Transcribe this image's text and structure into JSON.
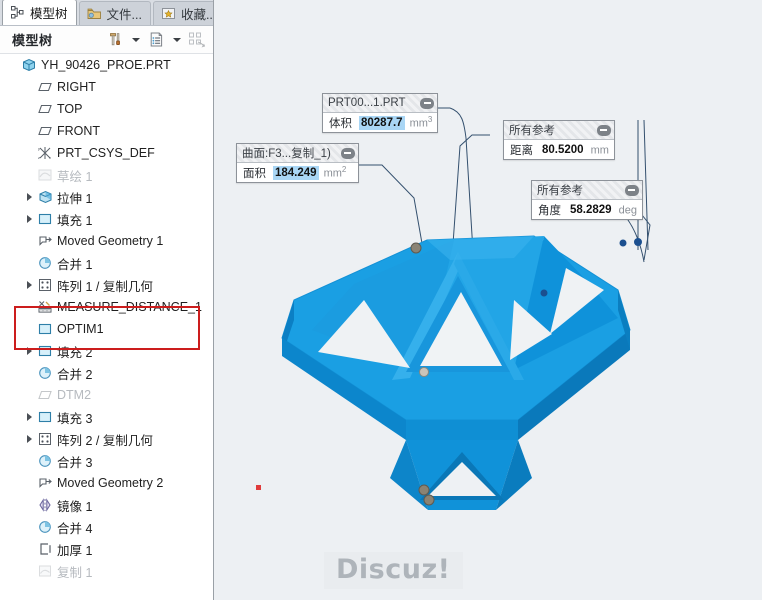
{
  "window": {
    "tabs": [
      {
        "label": "模型树",
        "icon": "model-tree-icon",
        "active": true
      },
      {
        "label": "文件...",
        "icon": "folder-icon",
        "active": false
      },
      {
        "label": "收藏...",
        "icon": "favorites-star-icon",
        "active": false
      }
    ]
  },
  "tree_toolbar": {
    "title": "模型树",
    "settings_icon": "tools-hammer-icon",
    "settings_caret": "chevron-down-icon",
    "display_icon": "list-settings-icon",
    "display_caret": "chevron-down-icon",
    "filter_icon": "tree-filter-off-icon"
  },
  "tree": {
    "items": [
      {
        "label": "YH_90426_PROE.PRT",
        "indent": 0,
        "icon": "part-icon",
        "expand": false,
        "dim": false
      },
      {
        "label": "RIGHT",
        "indent": 1,
        "icon": "datum-plane-icon",
        "expand": false,
        "dim": false
      },
      {
        "label": "TOP",
        "indent": 1,
        "icon": "datum-plane-icon",
        "expand": false,
        "dim": false
      },
      {
        "label": "FRONT",
        "indent": 1,
        "icon": "datum-plane-icon",
        "expand": false,
        "dim": false
      },
      {
        "label": "PRT_CSYS_DEF",
        "indent": 1,
        "icon": "csys-icon",
        "expand": false,
        "dim": false
      },
      {
        "label": "草绘 1",
        "indent": 1,
        "icon": "sketch-icon",
        "expand": false,
        "dim": true
      },
      {
        "label": "拉伸 1",
        "indent": 1,
        "icon": "extrude-icon",
        "expand": true,
        "dim": false
      },
      {
        "label": "填充 1",
        "indent": 1,
        "icon": "fill-icon",
        "expand": true,
        "dim": false
      },
      {
        "label": "Moved Geometry 1",
        "indent": 1,
        "icon": "moved-geometry-icon",
        "expand": false,
        "dim": false
      },
      {
        "label": "合并 1",
        "indent": 1,
        "icon": "merge-icon",
        "expand": false,
        "dim": false
      },
      {
        "label": "阵列 1 / 复制几何",
        "indent": 1,
        "icon": "pattern-icon",
        "expand": true,
        "dim": false
      },
      {
        "label": "MEASURE_DISTANCE_1",
        "indent": 1,
        "icon": "measure-distance-icon",
        "expand": false,
        "dim": false
      },
      {
        "label": "OPTIM1",
        "indent": 1,
        "icon": "fill-icon",
        "expand": false,
        "dim": false
      },
      {
        "label": "填充 2",
        "indent": 1,
        "icon": "fill-icon",
        "expand": true,
        "dim": false
      },
      {
        "label": "合并 2",
        "indent": 1,
        "icon": "merge-icon",
        "expand": false,
        "dim": false
      },
      {
        "label": "DTM2",
        "indent": 1,
        "icon": "datum-plane-icon",
        "expand": false,
        "dim": true
      },
      {
        "label": "填充 3",
        "indent": 1,
        "icon": "fill-icon",
        "expand": true,
        "dim": false
      },
      {
        "label": "阵列 2 / 复制几何",
        "indent": 1,
        "icon": "pattern-icon",
        "expand": true,
        "dim": false
      },
      {
        "label": "合并 3",
        "indent": 1,
        "icon": "merge-icon",
        "expand": false,
        "dim": false
      },
      {
        "label": "Moved Geometry 2",
        "indent": 1,
        "icon": "moved-geometry-icon",
        "expand": false,
        "dim": false
      },
      {
        "label": "镜像 1",
        "indent": 1,
        "icon": "mirror-icon",
        "expand": false,
        "dim": false
      },
      {
        "label": "合并 4",
        "indent": 1,
        "icon": "merge-icon",
        "expand": false,
        "dim": false
      },
      {
        "label": "加厚 1",
        "indent": 1,
        "icon": "thicken-icon",
        "expand": false,
        "dim": false
      },
      {
        "label": "复制 1",
        "indent": 1,
        "icon": "copy-icon",
        "expand": false,
        "dim": true
      }
    ],
    "selection_highlight_color": "#cc1d1d"
  },
  "callouts": [
    {
      "name": "volume-callout",
      "title": "PRT00...1.PRT",
      "label": "体积",
      "value": "80287.7",
      "unit": "mm",
      "unit_sup": "3",
      "collapse_icon": "minus-icon",
      "label_highlighted": false,
      "value_highlighted": true
    },
    {
      "name": "area-callout",
      "title": "曲面:F3...复制_1)",
      "label": "面积",
      "value": "184.249",
      "unit": "mm",
      "unit_sup": "2",
      "collapse_icon": "minus-icon",
      "label_highlighted": false,
      "value_highlighted": true
    },
    {
      "name": "distance-callout",
      "title": "所有参考",
      "label": "距离",
      "value": "80.5200",
      "unit": "mm",
      "unit_sup": "",
      "collapse_icon": "minus-icon",
      "label_highlighted": false,
      "value_highlighted": false
    },
    {
      "name": "angle-callout",
      "title": "所有参考",
      "label": "角度",
      "value": "58.2829",
      "unit": "deg",
      "unit_sup": "",
      "collapse_icon": "minus-icon",
      "label_highlighted": false,
      "value_highlighted": false
    }
  ],
  "viewport": {
    "background_color": "#edf0f3",
    "model_color": "#0f9ae3",
    "model_shadow_color": "#0b7ec0",
    "watermark": "Discuz!"
  }
}
